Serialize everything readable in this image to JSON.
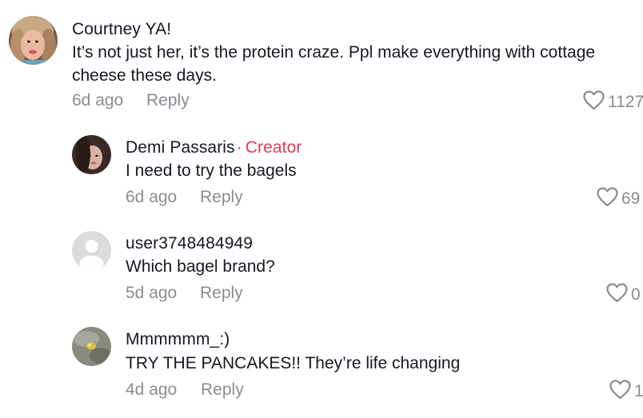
{
  "comments": [
    {
      "username": "Courtney YA!",
      "text_line1": "It’s not just her, it’s the protein craze. Ppl make everything with cottage",
      "text_line2": "cheese these days.",
      "time": "6d ago",
      "reply_label": "Reply",
      "likes": "1127"
    },
    {
      "username": "Demi Passaris",
      "creator_label": "Creator",
      "creator_separator": "·",
      "text_line1": "I need to try the bagels",
      "time": "6d ago",
      "reply_label": "Reply",
      "likes": "69"
    },
    {
      "username": "user3748484949",
      "text_line1": "Which bagel brand?",
      "time": "5d ago",
      "reply_label": "Reply",
      "likes": "0"
    },
    {
      "username": "Mmmmmm_:)",
      "text_line1": "TRY THE PANCAKES!! They’re life changing",
      "time": "4d ago",
      "reply_label": "Reply",
      "likes": "1"
    }
  ],
  "icons": {
    "like": "heart-outline-icon"
  },
  "colors": {
    "creator_accent": "#e8365d",
    "secondary_text": "#8a8b91",
    "primary_text": "#161823"
  }
}
